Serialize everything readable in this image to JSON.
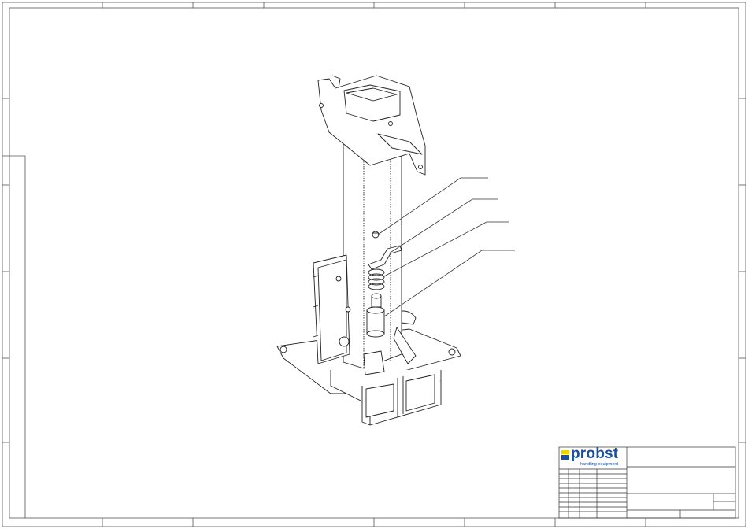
{
  "title_block": {
    "logo": {
      "name": "probst",
      "tagline": "handling equipment"
    },
    "colors": {
      "brand_blue": "#1b4f9c",
      "brand_yellow": "#f2d400"
    }
  },
  "drawing": {
    "type": "isometric exploded assembly drawing",
    "callout_count": 4,
    "icons": [
      "frame-border",
      "assembly-view",
      "leader-lines",
      "title-block"
    ]
  }
}
